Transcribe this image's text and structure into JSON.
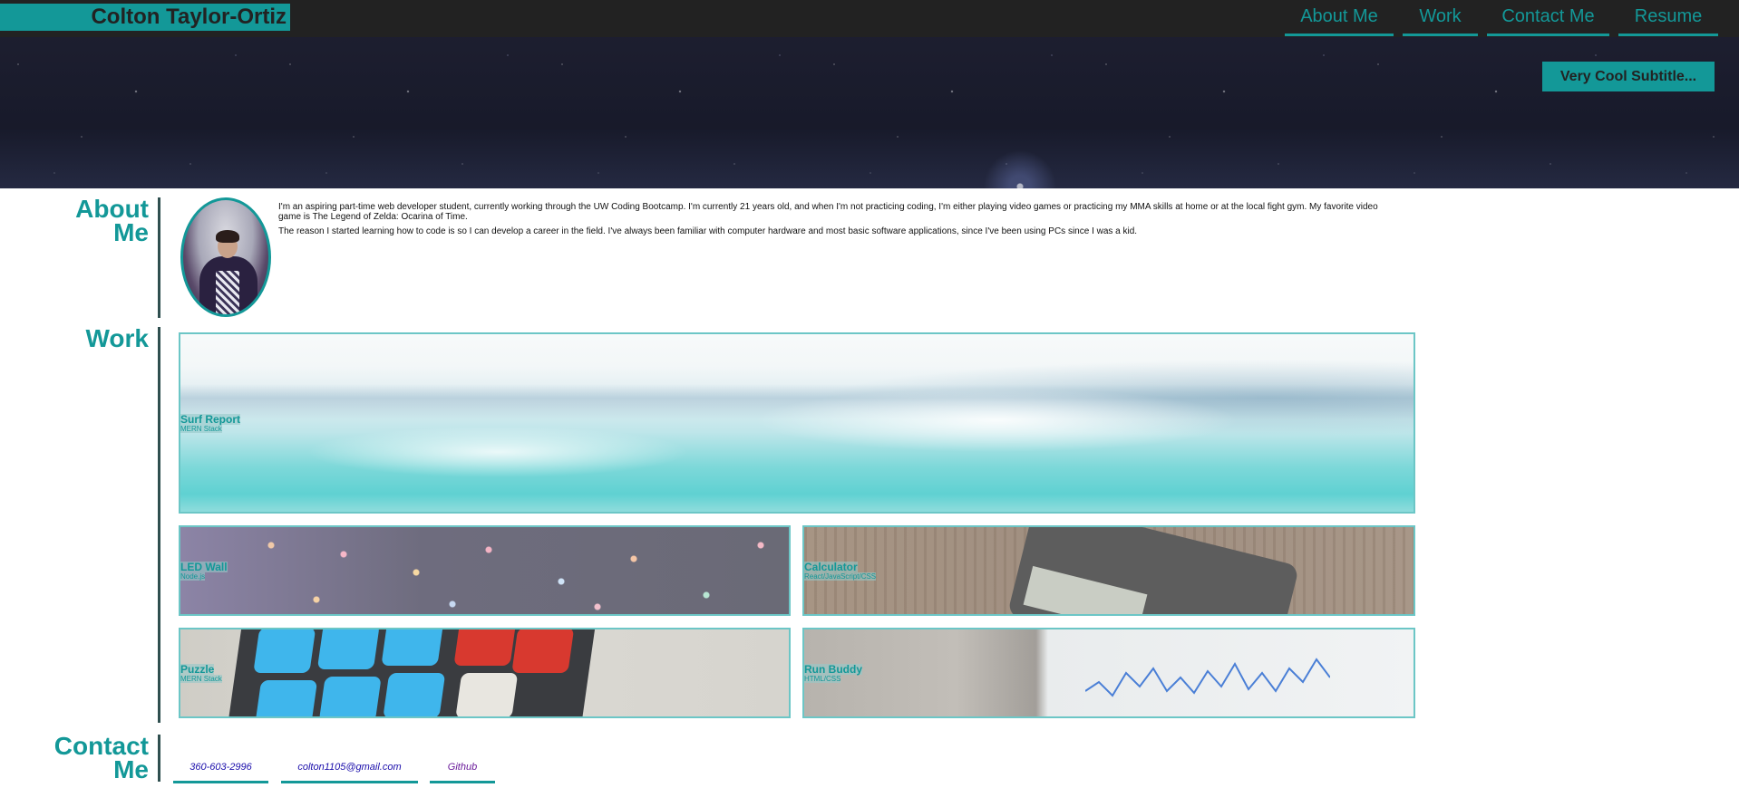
{
  "header": {
    "brand": "Colton Taylor-Ortiz",
    "nav": [
      {
        "label": "About Me"
      },
      {
        "label": "Work"
      },
      {
        "label": "Contact Me"
      },
      {
        "label": "Resume"
      }
    ]
  },
  "hero": {
    "subtitle": "Very Cool Subtitle..."
  },
  "about": {
    "title": "About Me",
    "paragraphs": [
      "I'm an aspiring part-time web developer student, currently working through the UW Coding Bootcamp. I'm currently 21 years old, and when I'm not practicing coding, I'm either playing video games or practicing my MMA skills at home or at the local fight gym. My favorite video game is The Legend of Zelda: Ocarina of Time.",
      "The reason I started learning how to code is so I can develop a career in the field. I've always been familiar with computer hardware and most basic software applications, since I've been using PCs since I was a kid."
    ]
  },
  "work": {
    "title": "Work",
    "projects": [
      {
        "name": "Surf Report",
        "tech": "MERN Stack"
      },
      {
        "name": "LED Wall",
        "tech": "Node.js"
      },
      {
        "name": "Calculator",
        "tech": "React/JavaScript/CSS"
      },
      {
        "name": "Puzzle",
        "tech": "MERN Stack"
      },
      {
        "name": "Run Buddy",
        "tech": "HTML/CSS"
      }
    ]
  },
  "contact": {
    "title": "Contact Me",
    "links": [
      {
        "label": "360-603-2996",
        "color": "#1a0dab"
      },
      {
        "label": "colton1105@gmail.com",
        "color": "#1a0dab"
      },
      {
        "label": "Github",
        "color": "#6a1b9a"
      }
    ]
  },
  "colors": {
    "accent": "#139898",
    "topbar": "#222222",
    "section_bar": "#2f4f4f"
  }
}
